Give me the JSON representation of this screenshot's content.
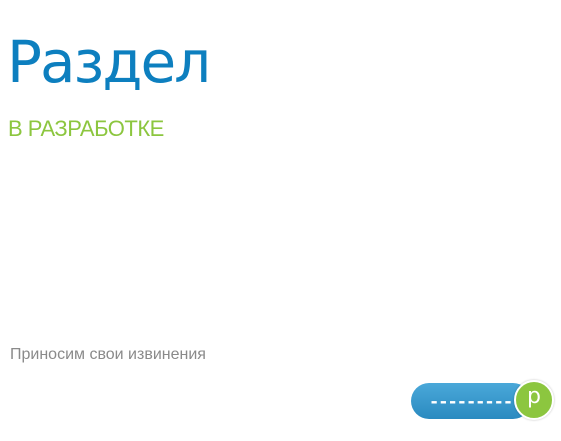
{
  "heading": {
    "title": "Раздел",
    "subtitle": "В РАЗРАБОТКЕ"
  },
  "message": {
    "apology": "Приносим свои извинения"
  },
  "badge": {
    "label": "---------",
    "circle_letter": "р"
  },
  "colors": {
    "title": "#0d7fbf",
    "subtitle": "#8cc63f",
    "badge_bg": "#2f94c8",
    "badge_circle": "#8cc63f",
    "apology_text": "#8a8a8a"
  }
}
